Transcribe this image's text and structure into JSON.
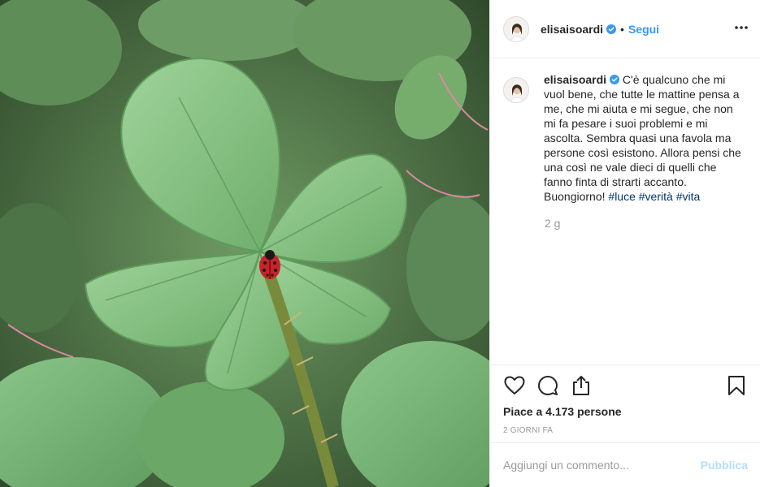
{
  "post": {
    "image_alt": "leaves-with-ladybug-photo"
  },
  "header": {
    "username": "elisaisoardi",
    "separator": "•",
    "follow_label": "Segui"
  },
  "caption": {
    "username": "elisaisoardi",
    "text": " C'è qualcuno che mi vuol bene, che tutte le mattine pensa a me, che mi aiuta e mi segue, che non mi fa pesare i suoi problemi e mi ascolta. Sembra quasi una favola ma persone così esistono. Allora pensi che una così ne vale dieci di quelli che fanno finta di strarti accanto. Buongiorno! ",
    "hashtags": [
      "#luce",
      "#verità",
      "#vita"
    ],
    "time_ago": "2 g"
  },
  "actions": {
    "like_icon": "heart-icon",
    "comment_icon": "comment-icon",
    "share_icon": "share-icon",
    "save_icon": "bookmark-icon"
  },
  "likes": {
    "text": "Piace a 4.173 persone"
  },
  "date": {
    "text": "2 giorni fa"
  },
  "comment": {
    "placeholder": "Aggiungi un commento...",
    "publish_label": "Pubblica"
  },
  "colors": {
    "accent": "#3897f0",
    "publish_disabled": "#b2dffc",
    "hashtag": "#003569",
    "muted": "#999999",
    "verified": "#3897f0"
  }
}
